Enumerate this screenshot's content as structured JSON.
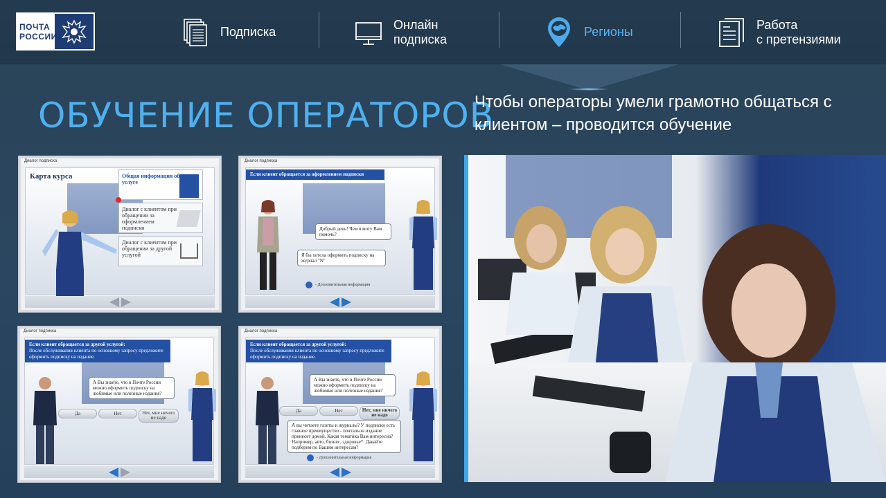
{
  "logo": {
    "line1": "ПОЧТА",
    "line2": "РОССИИ"
  },
  "nav": [
    {
      "label": "Подписка",
      "icon": "documents-stack-icon"
    },
    {
      "label": "Онлайн\nподписка",
      "icon": "monitor-icon"
    },
    {
      "label": "Регионы",
      "icon": "map-pin-russia-icon",
      "active": true
    },
    {
      "label": "Работа\nс претензиями",
      "icon": "claims-document-icon"
    }
  ],
  "colors": {
    "accent": "#4fb0ee",
    "active_nav": "#5ab3f2",
    "brand_blue": "#1e3c73"
  },
  "title": "ОБУЧЕНИЕ ОПЕРАТОРОВ",
  "subtitle": "Чтобы операторы умели грамотно общаться с клиентом – проводится обучение",
  "slides": [
    {
      "header": "Диалог подписка",
      "title": "Карта курса",
      "menu": [
        "Общая информация об услуге",
        "Диалог с клиентом при обращении за оформлением подписки",
        "Диалог с клиентом при обращении за другой услугой"
      ]
    },
    {
      "header": "Диалог подписка",
      "banner": "Если клиент обращается за оформлением подписки",
      "bubble_operator": "Добрый день! Чем я могу Вам помочь?",
      "bubble_client": "Я бы хотела оформить подписку на журнал \"N\"",
      "info": "- Дополнительная информация"
    },
    {
      "header": "Диалог подписка",
      "banner_title": "Если клиент обращается за другой услугой:",
      "banner_text": "После обслуживания клиента по основному запросу предложите оформить подписку на издание.",
      "bubble_operator": "А Вы знаете, что в Почте России можно оформить подписку на любимые или полезные издания?",
      "options": [
        "Да",
        "Нет",
        "Нет, мне ничего не надо"
      ]
    },
    {
      "header": "Диалог подписка",
      "banner_title": "Если клиент обращается за другой услугой:",
      "banner_text": "После обслуживания клиента по основному запросу предложите оформить подписку на издание.",
      "bubble_operator": "А Вы знаете, что в Почте России можно оформить подписку на любимые или полезные издания?",
      "options": [
        "Да",
        "Нет",
        "Нет, мне ничего не надо"
      ],
      "bubble_answer": "А вы читаете газеты и журналы? У подписки есть главное преимущество - почтальон издание принесет домой. Какая тематика Вам интересна? Например, авто, бизнес, здоровье*. Давайте подберем по Вашим интересам?",
      "info": "- Дополнительная информация"
    }
  ]
}
